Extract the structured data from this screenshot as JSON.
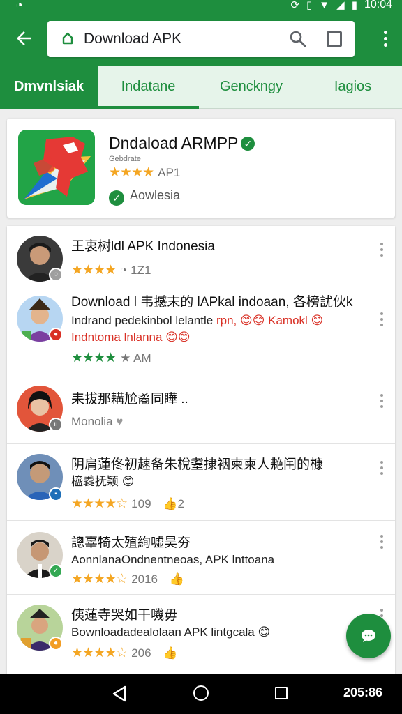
{
  "status_bar": {
    "time": "10:04"
  },
  "app_bar": {
    "search_query": "Download APK"
  },
  "tabs": [
    {
      "label": "Dmvnlsiak"
    },
    {
      "label": "Indatane"
    },
    {
      "label": "Genckngy"
    },
    {
      "label": "Iagios"
    }
  ],
  "app_card": {
    "title": "Dndaload ARMPP",
    "developer": "Gebdrate",
    "rating_stars": 3.5,
    "rating_text": "AP1",
    "status": "Aowlesia"
  },
  "reviews": [
    {
      "title": "王衷树ldl APK Indonesia",
      "rating_stars": 4,
      "meta": "1Z1"
    },
    {
      "title": "Download l 韦撼末的 lAPkal indoaan, 各榜訧伙k",
      "line2": "Indrand pedekinbol lelantle",
      "line2_red": "rpn, 😊😊 Kamokl 😊",
      "line3": "Indntoma lnlanna 😊😊",
      "rating_stars": 4,
      "meta": "AM"
    },
    {
      "title": "耒拔那耩尬矞同瞱 ..",
      "meta": "Monolia"
    },
    {
      "title": "阴肩蓮佟初趚备朱梲耋捸裀柬柬人艴闬的槺",
      "line2": "橀毳抚颖 😊",
      "rating_stars": 4.5,
      "meta": "109",
      "meta2": "2"
    },
    {
      "title": "謥辜犄太殖絢嘘昊夯",
      "line2": "AonnlanaOndnentneoas, APK lnttoana",
      "rating_stars": 4.5,
      "meta": "2016"
    },
    {
      "title": "侇蓮寺哭如干嘰毋",
      "line2": "Bownloadadealolaan APK lintgcala 😊",
      "rating_stars": 4.5,
      "meta": "206"
    }
  ],
  "nav_bar": {
    "clock": "205:86"
  },
  "colors": {
    "accent": "#1e8e3e",
    "tab_bg": "#e6f4ea",
    "star": "#f4a623",
    "red_text": "#d93025"
  },
  "icons": [
    "back-arrow-icon",
    "lock-icon",
    "search-icon",
    "tabs-icon",
    "overflow-menu-icon",
    "verified-icon",
    "check-circle-icon",
    "chat-bubble-icon",
    "nav-back-icon",
    "nav-home-icon",
    "nav-recents-icon"
  ]
}
